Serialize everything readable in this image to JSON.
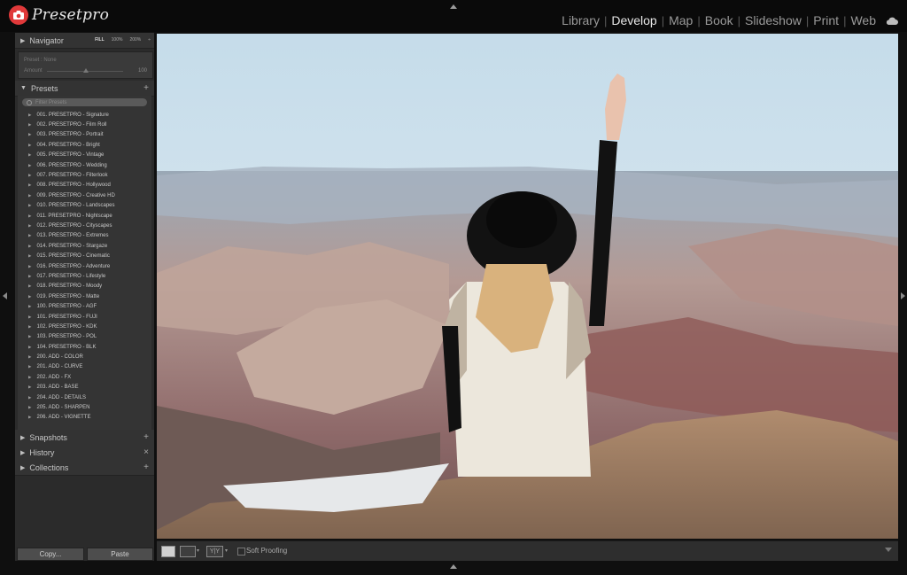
{
  "app": {
    "brand": "Presetpro",
    "modules": [
      {
        "label": "Library",
        "active": false
      },
      {
        "label": "Develop",
        "active": true
      },
      {
        "label": "Map",
        "active": false
      },
      {
        "label": "Book",
        "active": false
      },
      {
        "label": "Slideshow",
        "active": false
      },
      {
        "label": "Print",
        "active": false
      },
      {
        "label": "Web",
        "active": false
      }
    ],
    "separator": "|",
    "cloud_icon": "cloud-icon"
  },
  "navigator": {
    "title": "Navigator",
    "zoom": {
      "fill": "FILL",
      "z100": "100%",
      "z200": "200%",
      "menu": "÷"
    },
    "preset_label": "Preset : None",
    "amount_label": "Amount",
    "amount_value": "100"
  },
  "presets": {
    "title": "Presets",
    "add": "+",
    "search_placeholder": "Filter Presets",
    "items": [
      "001. PRESETPRO - Signature",
      "002. PRESETPRO - Film Roll",
      "003. PRESETPRO - Portrait",
      "004. PRESETPRO - Bright",
      "005. PRESETPRO - Vintage",
      "006. PRESETPRO - Wedding",
      "007. PRESETPRO - Filterlook",
      "008. PRESETPRO - Hollywood",
      "009. PRESETPRO - Creative HD",
      "010. PRESETPRO - Landscapes",
      "011. PRESETPRO - Nightscape",
      "012. PRESETPRO - Cityscapes",
      "013. PRESETPRO - Extremes",
      "014. PRESETPRO - Stargaze",
      "015. PRESETPRO - Cinematic",
      "016. PRESETPRO - Adventure",
      "017. PRESETPRO - Lifestyle",
      "018. PRESETPRO - Moody",
      "019. PRESETPRO - Matte",
      "100. PRESETPRO - AGF",
      "101. PRESETPRO - FUJI",
      "102. PRESETPRO - KDK",
      "103. PRESETPRO - POL",
      "104. PRESETPRO - BLK",
      "200. ADD - COLOR",
      "201. ADD - CURVE",
      "202. ADD - FX",
      "203. ADD - BASE",
      "204. ADD - DETAILS",
      "205. ADD - SHARPEN",
      "206. ADD - VIGNETTE"
    ]
  },
  "snapshots": {
    "title": "Snapshots",
    "action": "+"
  },
  "history": {
    "title": "History",
    "action": "×"
  },
  "collections": {
    "title": "Collections",
    "action": "+"
  },
  "footer": {
    "copy": "Copy...",
    "paste": "Paste"
  },
  "toolbar": {
    "soft_proofing": "Soft Proofing",
    "view_yy": "Y|Y"
  }
}
